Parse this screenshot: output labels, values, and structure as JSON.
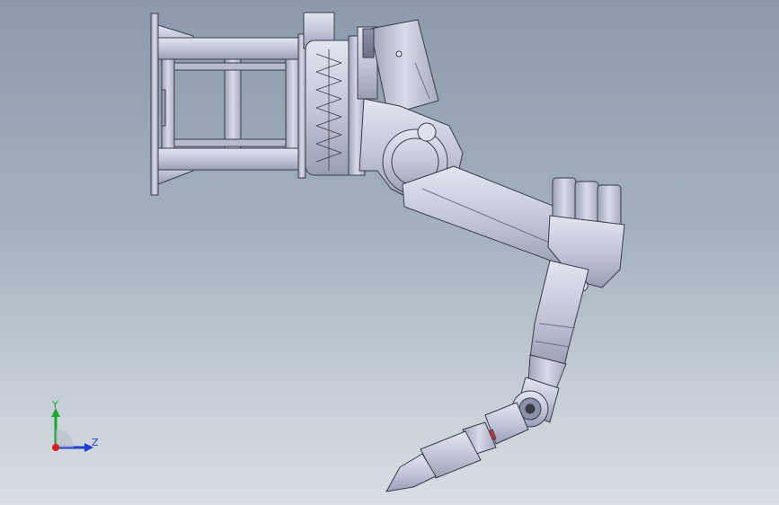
{
  "viewport": {
    "background_top": "#8c9aaa",
    "background_bottom": "#d8dee4"
  },
  "model": {
    "part_color": "#c5c9da",
    "edge_color": "#3a3d48",
    "highlight_color": "#d0303a"
  },
  "triad": {
    "y_label": "Y",
    "z_label": "Z",
    "y_color": "#1aaa2a",
    "z_color": "#1f3fd0",
    "x_color": "#d81e1e"
  }
}
